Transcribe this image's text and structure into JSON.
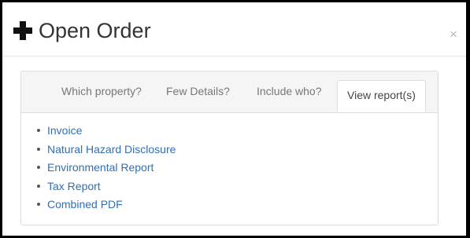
{
  "dialog": {
    "title": "Open Order",
    "close_label": "×"
  },
  "tabs": [
    {
      "label": "Which property?",
      "active": false
    },
    {
      "label": "Few Details?",
      "active": false
    },
    {
      "label": "Include who?",
      "active": false
    },
    {
      "label": "View report(s)",
      "active": true
    }
  ],
  "reports": [
    {
      "label": "Invoice"
    },
    {
      "label": "Natural Hazard Disclosure"
    },
    {
      "label": "Environmental Report"
    },
    {
      "label": "Tax Report"
    },
    {
      "label": "Combined PDF"
    }
  ],
  "colors": {
    "link": "#2f6fb6",
    "tab_inactive_text": "#777777",
    "tab_bar_bg": "#f5f5f5"
  },
  "icons": {
    "title_icon": "plus-icon",
    "list_bullet": "bullet-icon"
  }
}
